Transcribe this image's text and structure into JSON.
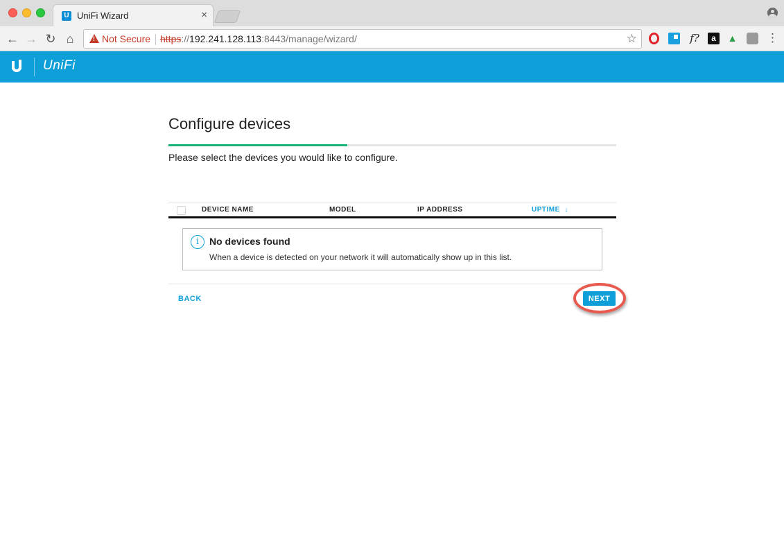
{
  "browser": {
    "tab_title": "UniFi Wizard",
    "tab_close": "×",
    "security_label": "Not Secure",
    "url_scheme": "https",
    "url_sep": "://",
    "url_host": "192.241.128.113",
    "url_rest": ":8443/manage/wizard/",
    "extensions": [
      "opera-icon",
      "tile-extension-icon",
      "font-finder-icon",
      "amazon-icon",
      "hill-icon",
      "gray-extension-icon"
    ],
    "ext_f_label": "f?",
    "ext_amazon_label": "a"
  },
  "app": {
    "brand": "UniFi",
    "accent_color": "#0e9fd9",
    "progress_color": "#1ab47a"
  },
  "wizard": {
    "title": "Configure devices",
    "progress": 0.4,
    "instructions": "Please select the devices you would like to configure.",
    "columns": [
      "DEVICE NAME",
      "MODEL",
      "IP ADDRESS",
      "UPTIME"
    ],
    "sorted_column": "UPTIME",
    "sort_direction_icon": "↓",
    "empty_title": "No devices found",
    "empty_text": "When a device is detected on your network it will automatically show up in this list.",
    "back_label": "BACK",
    "next_label": "NEXT",
    "highlight_color": "#e85a4f"
  }
}
